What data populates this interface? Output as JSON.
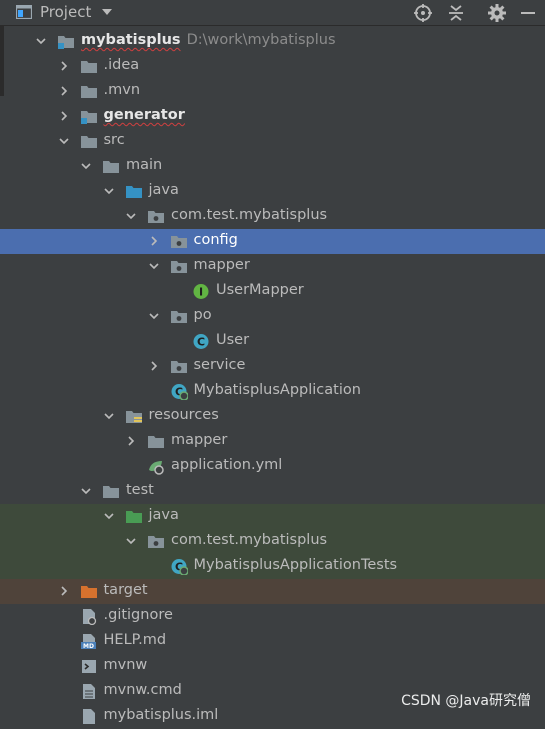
{
  "header": {
    "title": "Project",
    "tools": [
      "locate-icon",
      "collapse-icon",
      "gear-icon",
      "hide-icon"
    ]
  },
  "tree": [
    {
      "label": "mybatisplus",
      "path": "D:\\work\\mybatisplus",
      "depth": 0,
      "arrow": "down",
      "icon": "module-folder",
      "bold": true,
      "squiggle": true
    },
    {
      "label": ".idea",
      "depth": 1,
      "arrow": "right",
      "icon": "folder"
    },
    {
      "label": ".mvn",
      "depth": 1,
      "arrow": "right",
      "icon": "folder"
    },
    {
      "label": "generator",
      "depth": 1,
      "arrow": "right",
      "icon": "module-folder",
      "bold": true,
      "squiggle": true
    },
    {
      "label": "src",
      "depth": 1,
      "arrow": "down",
      "icon": "folder"
    },
    {
      "label": "main",
      "depth": 2,
      "arrow": "down",
      "icon": "folder"
    },
    {
      "label": "java",
      "depth": 3,
      "arrow": "down",
      "icon": "source-folder"
    },
    {
      "label": "com.test.mybatisplus",
      "depth": 4,
      "arrow": "down",
      "icon": "package"
    },
    {
      "label": "config",
      "depth": 5,
      "arrow": "right",
      "icon": "package",
      "selected": true
    },
    {
      "label": "mapper",
      "depth": 5,
      "arrow": "down",
      "icon": "package"
    },
    {
      "label": "UserMapper",
      "depth": 6,
      "arrow": "none",
      "icon": "interface"
    },
    {
      "label": "po",
      "depth": 5,
      "arrow": "down",
      "icon": "package"
    },
    {
      "label": "User",
      "depth": 6,
      "arrow": "none",
      "icon": "class"
    },
    {
      "label": "service",
      "depth": 5,
      "arrow": "right",
      "icon": "package"
    },
    {
      "label": "MybatisplusApplication",
      "depth": 5,
      "arrow": "none",
      "icon": "spring-class"
    },
    {
      "label": "resources",
      "depth": 3,
      "arrow": "down",
      "icon": "resources-folder"
    },
    {
      "label": "mapper",
      "depth": 4,
      "arrow": "right",
      "icon": "folder"
    },
    {
      "label": "application.yml",
      "depth": 4,
      "arrow": "none",
      "icon": "spring-yml"
    },
    {
      "label": "test",
      "depth": 2,
      "arrow": "down",
      "icon": "folder"
    },
    {
      "label": "java",
      "depth": 3,
      "arrow": "down",
      "icon": "test-folder",
      "bg": "test"
    },
    {
      "label": "com.test.mybatisplus",
      "depth": 4,
      "arrow": "down",
      "icon": "package",
      "bg": "test"
    },
    {
      "label": "MybatisplusApplicationTests",
      "depth": 5,
      "arrow": "none",
      "icon": "spring-test-class",
      "bg": "test"
    },
    {
      "label": "target",
      "depth": 1,
      "arrow": "right",
      "icon": "excluded-folder",
      "bg": "excl"
    },
    {
      "label": ".gitignore",
      "depth": 1,
      "arrow": "none",
      "icon": "gitignore-file"
    },
    {
      "label": "HELP.md",
      "depth": 1,
      "arrow": "none",
      "icon": "md-file"
    },
    {
      "label": "mvnw",
      "depth": 1,
      "arrow": "none",
      "icon": "shell-file"
    },
    {
      "label": "mvnw.cmd",
      "depth": 1,
      "arrow": "none",
      "icon": "text-file"
    },
    {
      "label": "mybatisplus.iml",
      "depth": 1,
      "arrow": "none",
      "icon": "iml-file"
    }
  ],
  "watermark": "CSDN @Java研究僧",
  "colors": {
    "background": "#3c3f41",
    "selection": "#4b6eaf",
    "test_root": "#3e4a3b",
    "excluded": "#4f433a",
    "folder": "#87939a",
    "source_folder": "#3592c4",
    "test_folder": "#499c54",
    "excluded_folder": "#d6722e"
  }
}
